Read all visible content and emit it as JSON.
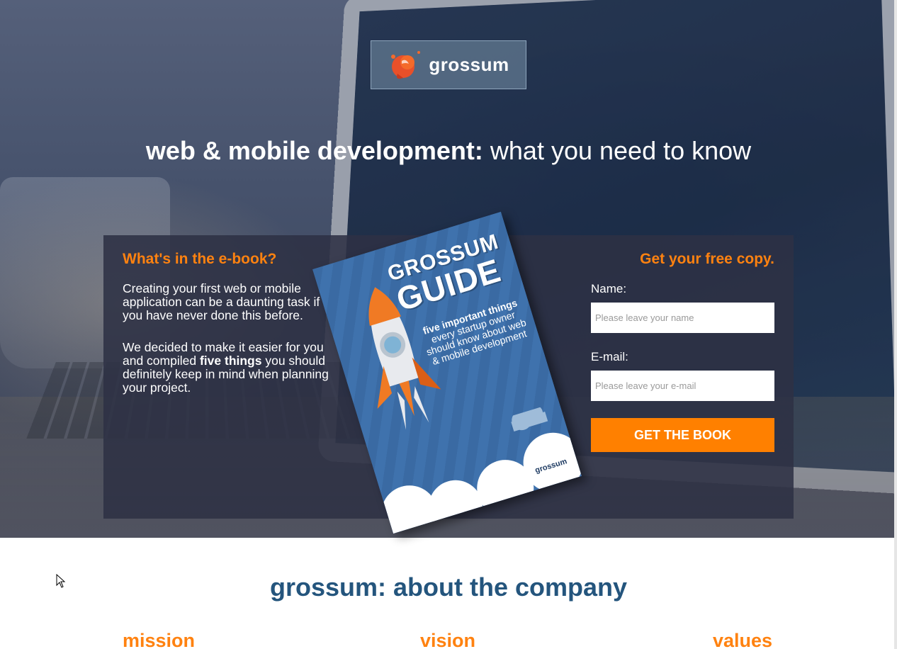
{
  "brand": {
    "logo_text": "grossum",
    "accent_color": "#ff8000",
    "logo_color": "#e8502a"
  },
  "hero": {
    "headline_bold": "web & mobile development:",
    "headline_light": " what you need to know"
  },
  "ebook": {
    "title": "What's in the e-book?",
    "paragraph1": "Creating your first web or mobile application can be a daunting task if you have never done this before.",
    "paragraph2_start": "We decided to make it easier for you and compiled ",
    "paragraph2_bold": "five things",
    "paragraph2_end": " you should definitely keep in mind when planning your project."
  },
  "book_cover": {
    "title_line1": "GROSSUM",
    "title_line2": "GUIDE",
    "subtitle_bold": "five important things",
    "subtitle_rest": "every startup owner should know about web & mobile development",
    "brand": "grossum"
  },
  "form": {
    "title": "Get your free copy.",
    "name_label": "Name:",
    "name_placeholder": "Please leave your name",
    "email_label": "E-mail:",
    "email_placeholder": "Please leave your e-mail",
    "submit_label": "GET THE BOOK"
  },
  "about": {
    "title_bold": "grossum:",
    "title_light": " about the company",
    "columns": [
      "mission",
      "vision",
      "values"
    ]
  }
}
